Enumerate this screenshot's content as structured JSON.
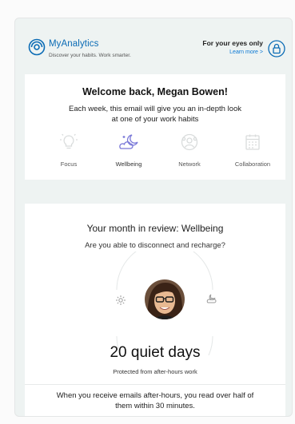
{
  "header": {
    "brand_name": "MyAnalytics",
    "brand_tagline": "Discover your habits. Work smarter.",
    "private_label": "For your eyes only",
    "learn_more": "Learn more  >"
  },
  "welcome_card": {
    "title": "Welcome back, Megan Bowen!",
    "intro": "Each week, this email will give you an in-depth look at one of your work habits",
    "habits": [
      {
        "label": "Focus",
        "icon": "lightbulb-icon",
        "active": false
      },
      {
        "label": "Wellbeing",
        "icon": "moon-cloud-icon",
        "active": true
      },
      {
        "label": "Network",
        "icon": "network-icon",
        "active": false
      },
      {
        "label": "Collaboration",
        "icon": "calendar-icon",
        "active": false
      }
    ]
  },
  "review_card": {
    "title": "Your month in review: Wellbeing",
    "question": "Are you able to disconnect and recharge?",
    "quiet_days": "20 quiet days",
    "quiet_sub": "Protected from after-hours work",
    "after_hours_text": "When you receive emails after-hours, you read over half of them within 30 minutes."
  },
  "colors": {
    "brand": "#0a6bb5",
    "link": "#0a78d4",
    "active_icon": "#7a78d8",
    "inactive_icon": "#d9dcdc",
    "panel_bg": "#eef3f2"
  }
}
